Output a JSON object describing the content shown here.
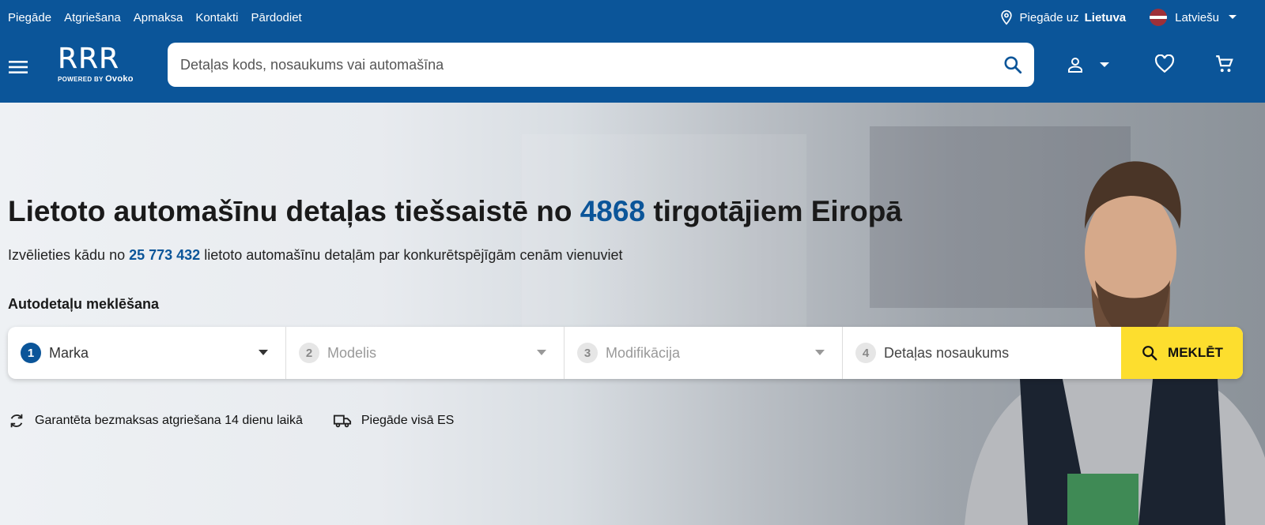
{
  "topbar": {
    "links": [
      "Piegāde",
      "Atgriešana",
      "Apmaksa",
      "Kontakti",
      "Pārdodiet"
    ],
    "delivery_prefix": "Piegāde uz",
    "delivery_country": "Lietuva",
    "language": "Latviešu"
  },
  "logo": {
    "mark": "RRR",
    "powered_by": "POWERED BY",
    "brand": "Ovoko"
  },
  "search": {
    "placeholder": "Detaļas kods, nosaukums vai automašīna"
  },
  "hero": {
    "title_prefix": "Lietoto automašīnu detaļas tiešsaistē no",
    "seller_count": "4868",
    "title_suffix": "tirgotājiem Eiropā",
    "subtitle_prefix": "Izvēlieties kādu no",
    "parts_count": "25 773 432",
    "subtitle_suffix": "lietoto automašīnu detaļām par konkurētspējīgām cenām vienuviet",
    "finder_label": "Autodetaļu meklēšana"
  },
  "finder": {
    "steps": [
      {
        "num": "1",
        "label": "Marka"
      },
      {
        "num": "2",
        "label": "Modelis"
      },
      {
        "num": "3",
        "label": "Modifikācija"
      },
      {
        "num": "4",
        "label": "Detaļas nosaukums"
      }
    ],
    "button": "MEKLĒT"
  },
  "features": {
    "returns": "Garantēta bezmaksas atgriešana 14 dienu laikā",
    "shipping": "Piegāde visā ES"
  },
  "colors": {
    "brand_blue": "#0b5599",
    "accent_yellow": "#fdde2e"
  }
}
